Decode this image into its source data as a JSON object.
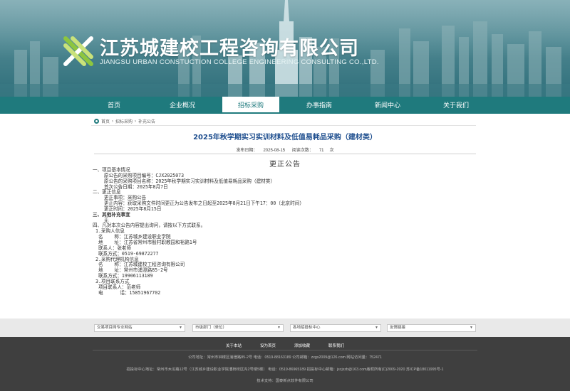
{
  "header": {
    "company_name": "江苏城建校工程咨询有限公司",
    "company_name_en": "JIANGSU URBAN CONSTUCTION COLLEGE ENGINEERING CONSULTING CO.,LTD."
  },
  "nav": {
    "items": [
      {
        "label": "首页"
      },
      {
        "label": "企业概况"
      },
      {
        "label": "招标采购"
      },
      {
        "label": "办事指南"
      },
      {
        "label": "新闻中心"
      },
      {
        "label": "关于我们"
      }
    ],
    "active_index": 2
  },
  "breadcrumb": {
    "home": "首页",
    "sep1": "›",
    "level1": "招标采购",
    "sep2": "›",
    "level2": "补充公告"
  },
  "article": {
    "title": "2025年秋学期实习实训材料及低值易耗品采购（建材类）",
    "publish_label": "发布日期：",
    "publish_date": "2025-08-15",
    "views_label": "阅读次数：",
    "views": "71",
    "views_unit": "次",
    "notice_title": "更正公告"
  },
  "body_lines": [
    {
      "text": "一、项目基本情况",
      "bold": false
    },
    {
      "text": "    原公告的采购项目编号：CJX2025073",
      "bold": false
    },
    {
      "text": "    原公告的采购项目名称：2025年秋学期实习实训材料及低值易耗品采购（建材类）",
      "bold": false
    },
    {
      "text": "    首次公告日期：2025年8月7日",
      "bold": false
    },
    {
      "text": "二、更正信息",
      "bold": false
    },
    {
      "text": "    更正事项：采购公告",
      "bold": false
    },
    {
      "text": "    更正内容：获取采购文件时间更正为公告发布之日起至2025年8月21日下午17：00（北京时间）",
      "bold": false
    },
    {
      "text": "    更正时间：2025年8月15日",
      "bold": false
    },
    {
      "text": "三、其他补充事宜",
      "bold": true
    },
    {
      "text": "    无",
      "bold": false
    },
    {
      "text": "四、凡对本次公告内容提出询问，请按以下方式联系。",
      "bold": false
    },
    {
      "text": " 1.采购人信息",
      "bold": false
    },
    {
      "text": "  名    称：江苏城乡建设职业学院",
      "bold": false
    },
    {
      "text": "  地    址：江苏省常州市殷村职教园和裕路1号",
      "bold": false
    },
    {
      "text": "  联系人：张老师",
      "bold": false
    },
    {
      "text": "  联系方式：0519-69872277",
      "bold": false
    },
    {
      "text": " 2.采购代理机构信息",
      "bold": false
    },
    {
      "text": "  名    称：江苏城建校工程咨询有限公司",
      "bold": false
    },
    {
      "text": "  地    址：常州市浦澄路85-2号",
      "bold": false
    },
    {
      "text": "  联系方式：19906113189",
      "bold": false
    },
    {
      "text": " 3.项目联系方式",
      "bold": false
    },
    {
      "text": "  项目联系人：范老师",
      "bold": false
    },
    {
      "text": "  电      话：15851967702",
      "bold": false
    }
  ],
  "linkbar": {
    "selects": [
      {
        "value": "交易项目网专业网站"
      },
      {
        "value": "市级部门（单位）"
      },
      {
        "value": "各地招投标中心"
      },
      {
        "value": "友情链接"
      }
    ]
  },
  "footer": {
    "links": [
      {
        "label": "关于本站"
      },
      {
        "label": "设为首页"
      },
      {
        "label": "添加收藏"
      },
      {
        "label": "联系我们"
      }
    ],
    "line1": "公司地址：常州市钟楼区浦澄路85-2号    电话：0519-88163189    公司邮箱：zxgs2009@126.com    网站访问量：752471",
    "line2": "招投标中心地址：常州市木瓜路12号（江苏城乡建设职业学院漕桥校区内2号楼5楼）    电话：0519-86965189    招投标中心邮箱：jscjxzb@163.com版权所有(C)2009-2020    苏ICP备18011995号-1",
    "line3": "技术支持：国泰新点软件有限公司"
  }
}
